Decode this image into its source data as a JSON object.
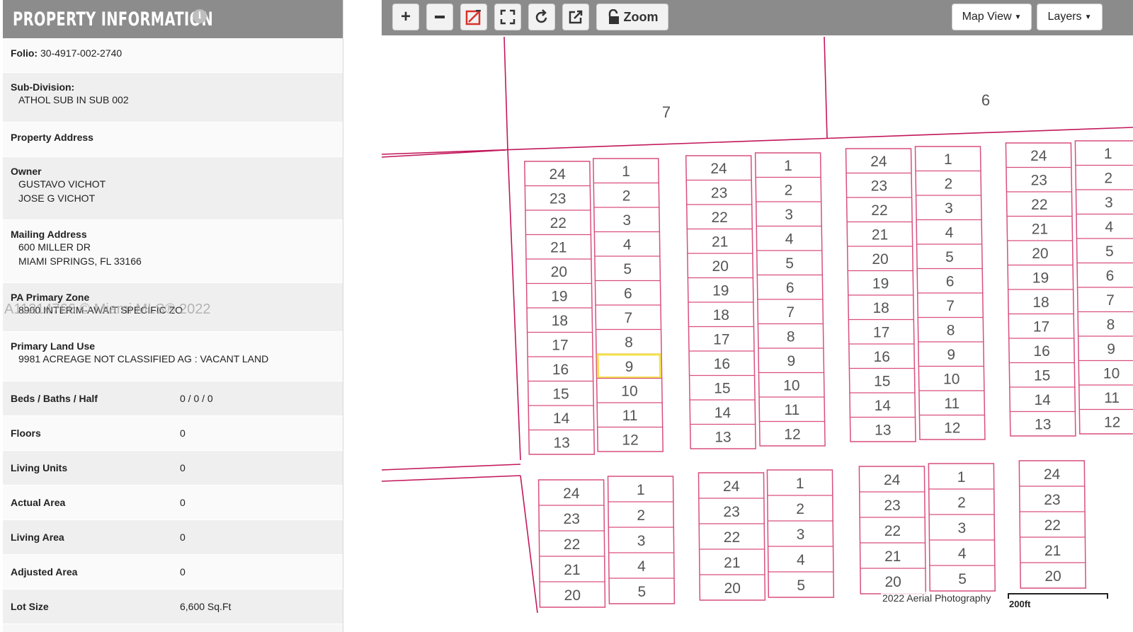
{
  "panel": {
    "title": "Property Information",
    "info_icon": "i",
    "folio_label": "Folio:",
    "folio_value": "30-4917-002-2740",
    "subdivision_label": "Sub-Division:",
    "subdivision_value": "ATHOL SUB IN SUB 002",
    "address_label": "Property Address",
    "owner_label": "Owner",
    "owners": [
      "GUSTAVO VICHOT",
      "JOSE G VICHOT"
    ],
    "mailing_label": "Mailing Address",
    "mailing_lines": [
      "600 MILLER DR",
      "MIAMI SPRINGS, FL 33166"
    ],
    "zone_label": "PA Primary Zone",
    "zone_value": "8900 INTERIM-AWAIT SPECIFIC ZO",
    "landuse_label": "Primary Land Use",
    "landuse_value": "9981 ACREAGE NOT CLASSIFIED AG : VACANT LAND",
    "pairs": [
      {
        "label": "Beds / Baths / Half",
        "value": "0 / 0 / 0"
      },
      {
        "label": "Floors",
        "value": "0"
      },
      {
        "label": "Living Units",
        "value": "0"
      },
      {
        "label": "Actual Area",
        "value": "0"
      },
      {
        "label": "Living Area",
        "value": "0"
      },
      {
        "label": "Adjusted Area",
        "value": "0"
      },
      {
        "label": "Lot Size",
        "value": "6,600 Sq.Ft"
      }
    ]
  },
  "watermark": "A11214766 © Miami MLS® 2022",
  "toolbar": {
    "zoom_label": "Zoom",
    "map_view_label": "Map View",
    "layers_label": "Layers"
  },
  "map": {
    "block_labels": [
      "7",
      "6"
    ],
    "highlight_color": "#f2e34a",
    "lot_line_color": "#d94f7e",
    "aerial_label": "2022 Aerial Photography",
    "scale_label": "200ft",
    "selected_lot": "9"
  }
}
